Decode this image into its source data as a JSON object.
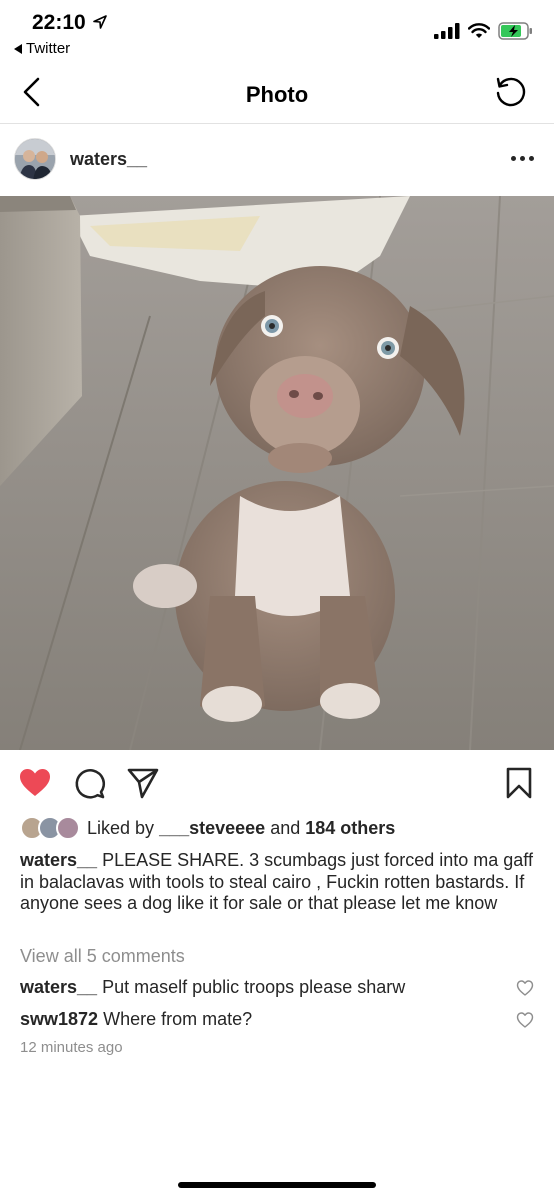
{
  "status_bar": {
    "time": "22:10",
    "back_app": "Twitter",
    "battery_color": "#34c759"
  },
  "nav": {
    "title": "Photo",
    "back_icon": "chevron-left-icon",
    "refresh_icon": "refresh-icon"
  },
  "post": {
    "username": "waters__",
    "more_icon": "more-horizontal-icon",
    "photo_alt": "Puppy photo",
    "actions": {
      "like_icon": "heart-filled-icon",
      "like_color": "#ed4956",
      "comment_icon": "comment-icon",
      "share_icon": "send-icon",
      "save_icon": "bookmark-icon"
    },
    "likes": {
      "prefix": "Liked by",
      "user": "___steveeee",
      "middle": "and",
      "others": "184 others"
    },
    "caption": {
      "username": "waters__",
      "text": "PLEASE SHARE. 3 scumbags just forced into ma gaff in balaclavas with tools to steal cairo , Fuckin rotten bastards. If anyone sees a dog like it for sale or that please let me know"
    },
    "view_comments": "View all 5 comments",
    "comments": [
      {
        "username": "waters__",
        "text": "Put maself public troops please sharw"
      },
      {
        "username": "sww1872",
        "text": "Where from mate?"
      }
    ],
    "timestamp": "12 minutes ago"
  }
}
